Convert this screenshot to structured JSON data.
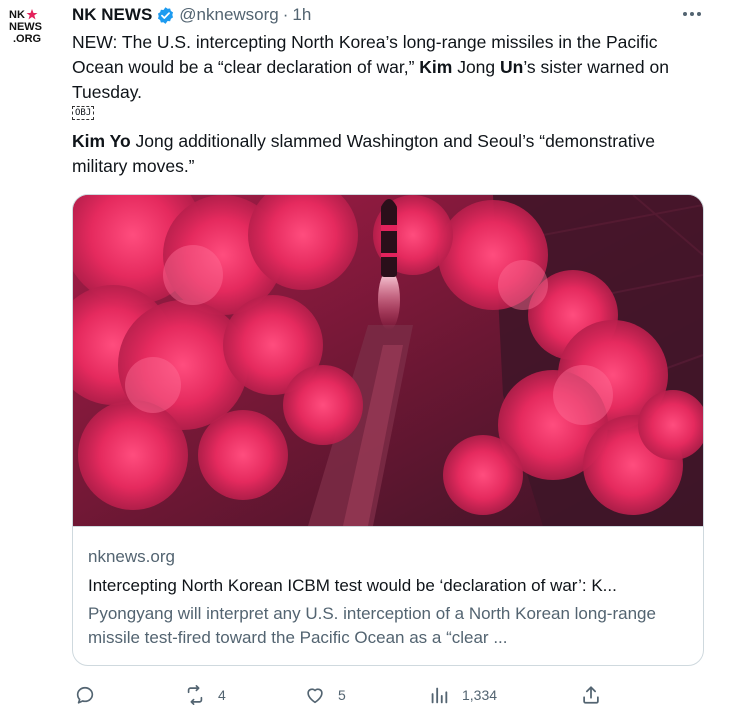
{
  "account": {
    "avatar_logo_text": [
      "NK",
      "NEWS",
      ".ORG"
    ],
    "name": "NK NEWS",
    "handle": "@nknewsorg",
    "separator": "·",
    "time": "1h",
    "verified_color": "#1d9bf0"
  },
  "tweet": {
    "para1": {
      "t1": "NEW: The U.S. intercepting North Korea’s long-range missiles in the Pacific Ocean would be a “clear declaration of war,” ",
      "b1": "Kim",
      "t2": " Jong ",
      "b2": "Un",
      "t3": "’s sister warned on Tuesday."
    },
    "obj_marker": "OBJ",
    "para2": {
      "b1": "Kim Yo",
      "t1": " Jong additionally slammed Washington and Seoul’s “demonstrative military moves.”"
    }
  },
  "card": {
    "domain": "nknews.org",
    "title": "Intercepting North Korean ICBM test would be ‘declaration of war’: K...",
    "description": "Pyongyang will interpret any U.S. interception of a North Korean long-range missile test-fired toward the Pacific Ocean as a “clear ..."
  },
  "actions": {
    "reply_icon": "reply-icon",
    "retweet_count": "4",
    "like_count": "5",
    "views_count": "1,334",
    "share_icon": "share-icon"
  },
  "colors": {
    "accent": "#1d9bf0",
    "image_tint": "#e3225c",
    "image_shadow": "#3a1426",
    "text_secondary": "#536471"
  }
}
